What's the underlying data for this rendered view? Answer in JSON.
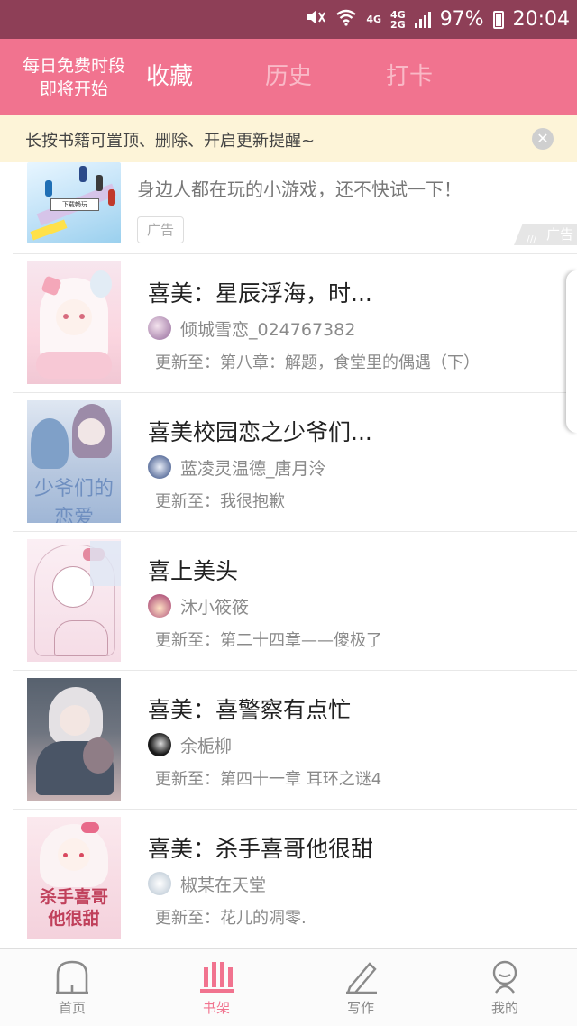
{
  "status_bar": {
    "battery": "97%",
    "time": "20:04",
    "network_top": "4G",
    "network_bottom": "2G",
    "network_main": "4G"
  },
  "header": {
    "promo_line1": "每日免费时段",
    "promo_line2": "即将开始",
    "tabs": [
      {
        "label": "收藏",
        "active": true
      },
      {
        "label": "历史",
        "active": false
      },
      {
        "label": "打卡",
        "active": false
      }
    ],
    "accent_color": "#f1738f"
  },
  "tip": {
    "text": "长按书籍可置顶、删除、开启更新提醒~",
    "close_icon": "close-icon"
  },
  "ad": {
    "text": "身边人都在玩的小游戏，还不快试一下！",
    "badge": "广告",
    "corner_label": "广告",
    "cover_sign": "下载畅玩"
  },
  "books": [
    {
      "title": "喜美：星辰浮海，时...",
      "author": "倾城雪恋_024767382",
      "update": "更新至：第八章：解题，食堂里的偶遇（下）"
    },
    {
      "title": "喜美校园恋之少爷们...",
      "author": "蓝凌灵温德_唐月泠",
      "update": "更新至：我很抱歉"
    },
    {
      "title": "喜上美头",
      "author": "沐小筱筱",
      "update": "更新至：第二十四章——傻极了"
    },
    {
      "title": "喜美：喜警察有点忙",
      "author": "余栀柳",
      "update": "更新至：第四十一章  耳环之谜4"
    },
    {
      "title": "喜美：杀手喜哥他很甜",
      "author": "椒某在天堂",
      "update": "更新至：花儿的凋零."
    }
  ],
  "cover_text": {
    "book2": "少爷们的恋爱",
    "book5_line1": "杀手喜哥",
    "book5_line2": "他很甜"
  },
  "bottom_nav": [
    {
      "label": "首页",
      "icon": "home-icon",
      "active": false
    },
    {
      "label": "书架",
      "icon": "bookshelf-icon",
      "active": true
    },
    {
      "label": "写作",
      "icon": "pen-icon",
      "active": false
    },
    {
      "label": "我的",
      "icon": "profile-icon",
      "active": false
    }
  ]
}
